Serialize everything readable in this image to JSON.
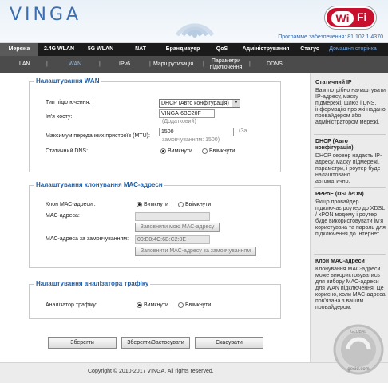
{
  "header": {
    "logo": "VINGA",
    "wifi_badge_left": "Wi",
    "wifi_badge_right": "Fi",
    "firmware": "Программе забезпечення: 81.102.1.4370"
  },
  "mainnav": [
    {
      "label": "Мережа"
    },
    {
      "label": "2.4G WLAN"
    },
    {
      "label": "5G WLAN"
    },
    {
      "label": "NAT"
    },
    {
      "label": "Брандмауер"
    },
    {
      "label": "QoS"
    },
    {
      "label": "Адміністрування"
    },
    {
      "label": "Статус"
    },
    {
      "label": "Домашня сторінка"
    }
  ],
  "subnav": {
    "lan": "LAN",
    "wan": "WAN",
    "ipv6": "IPv6",
    "routing": "Маршрутизація",
    "conn_params_1": "Параметри",
    "conn_params_2": "підключення",
    "ddns": "DDNS",
    "separator": "|"
  },
  "wan": {
    "legend": "Налаштування WAN",
    "conn_type_label": "Тип підключення:",
    "conn_type_value": "DHCP (Авто конфігурація)",
    "hostname_label": "Ім'я хосту:",
    "hostname_value": "VINGA-6BC20F",
    "hostname_hint": "(Додатковий)",
    "mtu_label": "Максимум передачних пристроїв (MTU):",
    "mtu_value": "1500",
    "mtu_hint_a": "(За",
    "mtu_hint_b": "замовчуванням: 1500)",
    "dns_label": "Статичний DNS:",
    "dns_on": "Вимкнути",
    "dns_off": "Ввімкнути"
  },
  "mac": {
    "legend": "Налаштування клонування МАС-адреси",
    "clone_label": "Клон МАС-адреси :",
    "clone_on": "Вимкнути",
    "clone_off": "Ввімкнути",
    "mac_label": "МАС-адреса:",
    "remember_button": "Заповнити мою МАС-адресу",
    "default_label": "МАС-адреса за замовчуванням:",
    "default_value": "00:E0:4C:6B:C2:0E",
    "default_button": "Заповнити МАС-адресу за замовчуванням"
  },
  "traffic": {
    "legend": "Налаштування аналізатора трафіку",
    "label": "Аналізатор трафіку:",
    "on": "Вимкнути",
    "off": "Ввімкнути"
  },
  "buttons": {
    "save": "Зберегти",
    "save_apply": "Зберегти/Застосувати",
    "cancel": "Скасувати"
  },
  "sidebar": {
    "static_ip_title": "Статичний IP",
    "static_ip_text": "Вам потрібно налаштувати IP-адресу, маску підмережі, шлюз і DNS, інформацію про які надано провайдером або адміністратором мережі.",
    "dhcp_title": "DHCP (Авто конфігурація)",
    "dhcp_text": "DHCP сервер надасть IP-адресу, маску підмережі, параметри, і роутер буде налаштовано автоматично.",
    "pppoe_title": "PPPoE (DSL/PON)",
    "pppoe_text": "Якщо провайдер підключає роутер до XDSL / xPON модему і роутер буде використовувати ім'я користувача та пароль для підключення до Інтернет.",
    "mac_title": "Клон МАС-адреси",
    "mac_text": "Клонування МАС-адреси може використовуватись для вибору МАС-адреси для WAN підключення. Це корисно, коли МАС-адреса пов'язана з вашим провайдером."
  },
  "footer": {
    "copyright": "Copyright © 2010-2017 VINGA, All rights reserved."
  },
  "watermark": {
    "brand": "GLOBAL",
    "domain": "gecid.com"
  }
}
